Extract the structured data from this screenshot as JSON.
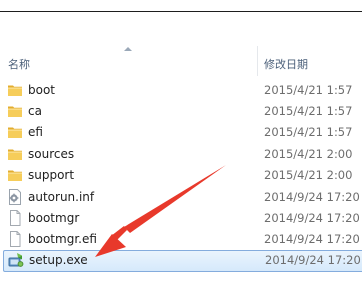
{
  "header": {
    "name_label": "名称",
    "date_label": "修改日期"
  },
  "files": [
    {
      "name": "boot",
      "date": "2015/4/21 1:57",
      "icon": "folder-icon"
    },
    {
      "name": "ca",
      "date": "2015/4/21 1:57",
      "icon": "folder-icon"
    },
    {
      "name": "efi",
      "date": "2015/4/21 1:57",
      "icon": "folder-icon"
    },
    {
      "name": "sources",
      "date": "2015/4/21 2:00",
      "icon": "folder-icon"
    },
    {
      "name": "support",
      "date": "2015/4/21 2:00",
      "icon": "folder-icon"
    },
    {
      "name": "autorun.inf",
      "date": "2014/9/24 17:20",
      "icon": "settings-file-icon"
    },
    {
      "name": "bootmgr",
      "date": "2014/9/24 17:20",
      "icon": "file-icon"
    },
    {
      "name": "bootmgr.efi",
      "date": "2014/9/24 17:20",
      "icon": "file-icon"
    },
    {
      "name": "setup.exe",
      "date": "2014/9/24 17:20",
      "icon": "setup-icon",
      "selected": true
    }
  ],
  "colors": {
    "annotation_arrow": "#e8392b",
    "selection_border": "#84acdd",
    "folder": "#f4c54a"
  }
}
